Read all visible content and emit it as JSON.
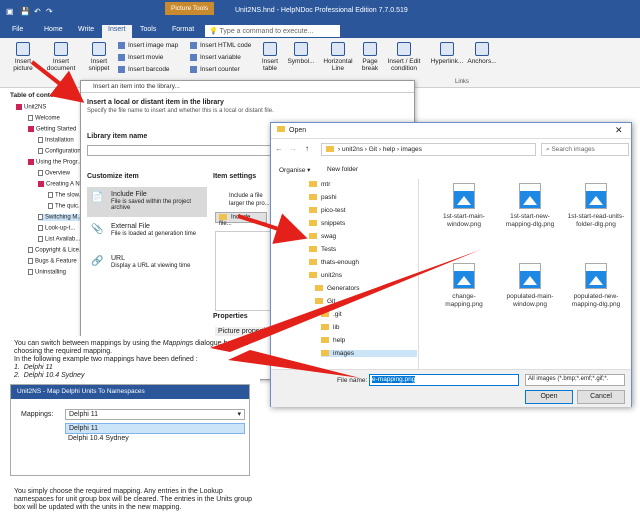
{
  "titlebar": {
    "context": "Picture Tools",
    "title": "Unit2NS.hnd - HelpNDoc Professional Edition 7.7.0.519"
  },
  "ribbon": {
    "tabs": [
      "File",
      "Home",
      "Write",
      "Insert",
      "Tools",
      "Format"
    ],
    "search_placeholder": "Type a command to execute...",
    "buttons": {
      "insert_picture": "Insert picture",
      "insert_document": "Insert document",
      "insert_snippet": "Insert snippet",
      "image_map": "Insert image map",
      "movie": "Insert movie",
      "barcode": "Insert barcode",
      "html_code": "Insert HTML code",
      "variable": "Insert variable",
      "counter": "Insert counter",
      "table": "Insert table",
      "symbol": "Symbol...",
      "hline": "Horizontal Line",
      "pagebreak": "Page break",
      "condition": "Insert / Edit condition",
      "hyperlink": "Hyperlink...",
      "anchors": "Anchors...",
      "links_group": "Links"
    }
  },
  "toc": {
    "title": "Table of contents",
    "items": [
      "Unit2NS",
      "Welcome",
      "Getting Started",
      "Installation",
      "Configuration",
      "Using the Progr...",
      "Overview",
      "Creating A N...",
      "The slow...",
      "The quic...",
      "Switching M...",
      "Look-up-t...",
      "List Availab...",
      "Copyright & Lice...",
      "Bugs & Feature",
      "Uninstalling"
    ]
  },
  "libdlg": {
    "title": "Insert an item into the library...",
    "heading": "Insert a local or distant item in the library",
    "subheading": "Specify the file name to insert and whether this is a local or distant file.",
    "name_label": "Library item name",
    "customize_label": "Customize item",
    "settings_label": "Item settings",
    "opt1_title": "Include File",
    "opt1_desc": "File is saved within the project archive",
    "opt2_title": "External File",
    "opt2_desc": "File is loaded at generation time",
    "opt3_title": "URL",
    "opt3_desc": "Display a URL at viewing time",
    "include_btn": "Include file...",
    "properties_label": "Properties",
    "picture_props": "Picture properties",
    "frag1": "Include a file",
    "frag2": "larger the pro..."
  },
  "opendlg": {
    "title": "Open",
    "breadcrumb": [
      "unit2ns",
      "Git",
      "help",
      "images"
    ],
    "search_placeholder": "Search images",
    "organise": "Organise",
    "new_folder": "New folder",
    "nav": [
      "mtr",
      "pashi",
      "pico-test",
      "snippets",
      "swag",
      "Tests",
      "thats-enough",
      "unit2ns",
      "Generators",
      "Git",
      ".git",
      "lib",
      "help",
      "images"
    ],
    "files": [
      "1st-start-main-window.png",
      "1st-start-new-mapping-dlg.png",
      "1st-start-read-units-folder-dlg.png",
      "change-mapping.png",
      "populated-main-window.png",
      "populated-new-mapping-dlg.png"
    ],
    "filename_label": "File name:",
    "filename_value": "e-mapping.png",
    "filetype": "All images (*.bmp;*.emf;*.gif;*.",
    "open_btn": "Open",
    "cancel_btn": "Cancel"
  },
  "doc": {
    "para1a": "You can switch between mappings by using the ",
    "para1b": "Mappings",
    "para1c": " dialogue box and choosing the required mapping.",
    "para2": "In the following example two mappings have been defined :",
    "list1": "Delphi 11",
    "list2": "Delphi 10.4 Sydney",
    "para3": "You simply choose the required mapping. Any entries in the Lookup namespaces for unit group box will be cleared. The entries in the Units group box will be updated with the units in the new mapping."
  },
  "subdlg": {
    "title": "Unit2NS - Map Delphi Units To Namespaces",
    "label": "Mappings:",
    "selected": "Delphi 11",
    "options": [
      "Delphi 11",
      "Delphi 10.4 Sydney"
    ]
  },
  "colors": {
    "brand": "#2b579a",
    "arrow": "#e3211a",
    "selection": "#cce4f7"
  }
}
